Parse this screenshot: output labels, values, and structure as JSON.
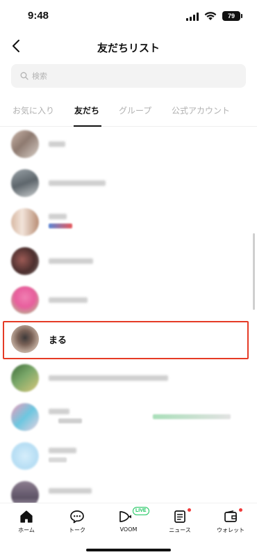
{
  "status": {
    "time": "9:48",
    "battery": "79"
  },
  "nav": {
    "title": "友だちリスト"
  },
  "search": {
    "placeholder": "検索"
  },
  "tabs": [
    {
      "label": "お気に入り"
    },
    {
      "label": "友だち"
    },
    {
      "label": "グループ"
    },
    {
      "label": "公式アカウント"
    }
  ],
  "friends": {
    "highlighted_name": "まる"
  },
  "bottom_nav": [
    {
      "label": "ホーム"
    },
    {
      "label": "トーク"
    },
    {
      "label": "VOOM"
    },
    {
      "label": "ニュース"
    },
    {
      "label": "ウォレット"
    }
  ],
  "badges": {
    "live": "LIVE"
  },
  "colors": {
    "highlight": "#e53a25",
    "live_green": "#19c55c",
    "notification_dot": "#ef3b3b"
  }
}
